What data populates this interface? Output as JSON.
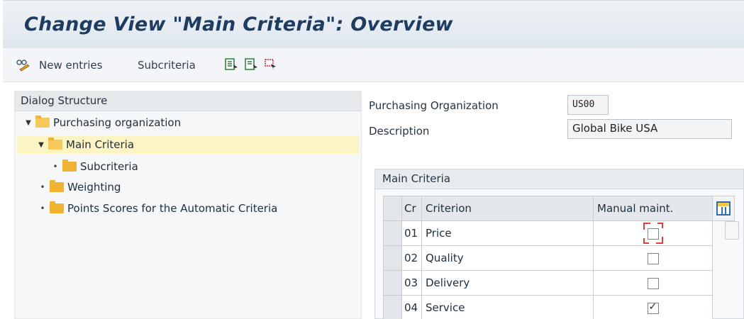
{
  "window": {
    "title": "Change View \"Main Criteria\": Overview"
  },
  "toolbar": {
    "new_entries_label": "New entries",
    "subcriteria_label": "Subcriteria",
    "icons": [
      "glasses-change-icon",
      "select-all-icon",
      "deselect-icon",
      "select-block-icon"
    ]
  },
  "dialog_structure": {
    "title": "Dialog Structure",
    "items": [
      {
        "label": "Purchasing organization",
        "expanded": true,
        "selected": false
      },
      {
        "label": "Main Criteria",
        "expanded": true,
        "selected": true
      },
      {
        "label": "Subcriteria",
        "expanded": false,
        "selected": false
      },
      {
        "label": "Weighting",
        "expanded": false,
        "selected": false
      },
      {
        "label": "Points Scores for the Automatic Criteria",
        "expanded": false,
        "selected": false
      }
    ]
  },
  "header_fields": {
    "purch_org_label": "Purchasing Organization",
    "purch_org_value": "US00",
    "description_label": "Description",
    "description_value": "Global Bike USA"
  },
  "main_criteria": {
    "title": "Main Criteria",
    "columns": {
      "cr": "Cr",
      "criterion": "Criterion",
      "manual": "Manual maint."
    },
    "rows": [
      {
        "cr": "01",
        "criterion": "Price",
        "manual": false,
        "focused": true
      },
      {
        "cr": "02",
        "criterion": "Quality",
        "manual": false,
        "focused": false
      },
      {
        "cr": "03",
        "criterion": "Delivery",
        "manual": false,
        "focused": false
      },
      {
        "cr": "04",
        "criterion": "Service",
        "manual": true,
        "focused": false
      }
    ]
  },
  "colors": {
    "title": "#1d3c5f",
    "selected_row": "#fdf4c4",
    "folder": "#f0b331",
    "focus": "#e0403a"
  }
}
